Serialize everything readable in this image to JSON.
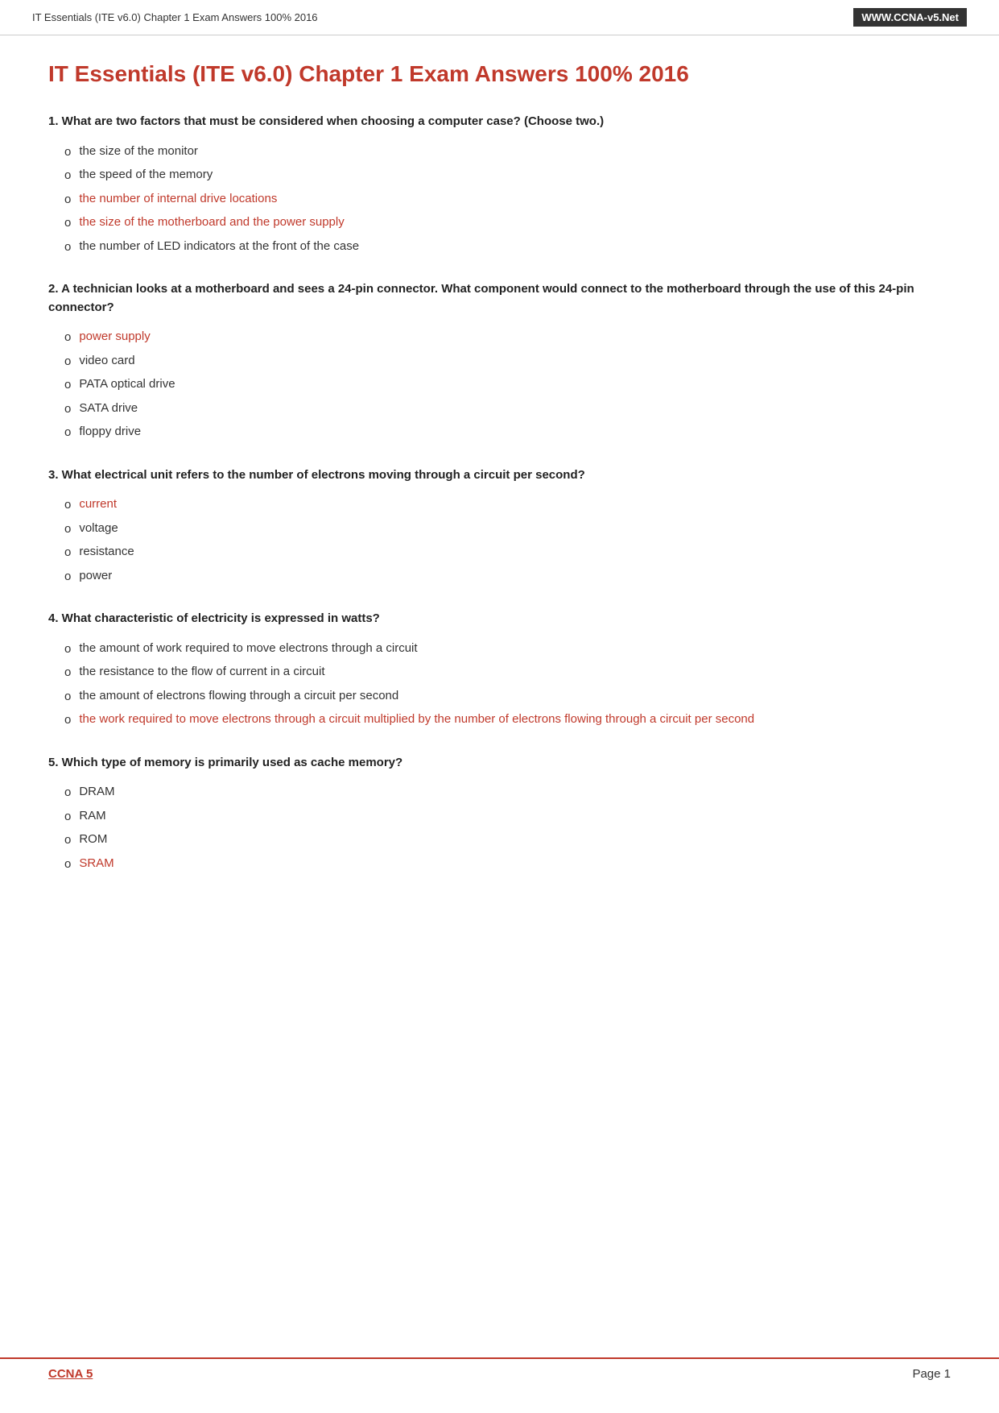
{
  "header": {
    "title": "IT Essentials (ITE v6.0) Chapter 1 Exam Answers 100% 2016",
    "badge": "WWW.CCNA-v5.Net"
  },
  "page_title": "IT Essentials (ITE v6.0) Chapter 1 Exam Answers 100% 2016",
  "questions": [
    {
      "id": "1",
      "text": "What are two factors that must be considered when choosing a computer case? (Choose two.)",
      "answers": [
        {
          "text": "the size of the monitor",
          "correct": false
        },
        {
          "text": "the speed of the memory",
          "correct": false
        },
        {
          "text": "the number of internal drive locations",
          "correct": true
        },
        {
          "text": "the size of the motherboard and the power supply",
          "correct": true
        },
        {
          "text": "the number of LED indicators at the front of the case",
          "correct": false
        }
      ]
    },
    {
      "id": "2",
      "text": "A technician looks at a motherboard and sees a 24-pin connector. What component would connect to the motherboard through the use of this 24-pin connector?",
      "answers": [
        {
          "text": "power supply",
          "correct": true
        },
        {
          "text": "video card",
          "correct": false
        },
        {
          "text": "PATA optical drive",
          "correct": false
        },
        {
          "text": "SATA drive",
          "correct": false
        },
        {
          "text": "floppy drive",
          "correct": false
        }
      ]
    },
    {
      "id": "3",
      "text": "What electrical unit refers to the number of electrons moving through a circuit per second?",
      "answers": [
        {
          "text": "current",
          "correct": true
        },
        {
          "text": "voltage",
          "correct": false
        },
        {
          "text": "resistance",
          "correct": false
        },
        {
          "text": "power",
          "correct": false
        }
      ]
    },
    {
      "id": "4",
      "text": "What characteristic of electricity is expressed in watts?",
      "answers": [
        {
          "text": "the amount of work required to move electrons through a circuit",
          "correct": false
        },
        {
          "text": "the resistance to the flow of current in a circuit",
          "correct": false
        },
        {
          "text": "the amount of electrons flowing through a circuit per second",
          "correct": false
        },
        {
          "text": "the work required to move electrons through a circuit multiplied by the number of electrons flowing through a circuit per second",
          "correct": true
        }
      ]
    },
    {
      "id": "5",
      "text": "Which type of memory is primarily used as cache memory?",
      "answers": [
        {
          "text": "DRAM",
          "correct": false
        },
        {
          "text": "RAM",
          "correct": false
        },
        {
          "text": "ROM",
          "correct": false
        },
        {
          "text": "SRAM",
          "correct": true
        }
      ]
    }
  ],
  "footer": {
    "link_text": "CCNA 5",
    "page_label": "Page 1"
  }
}
